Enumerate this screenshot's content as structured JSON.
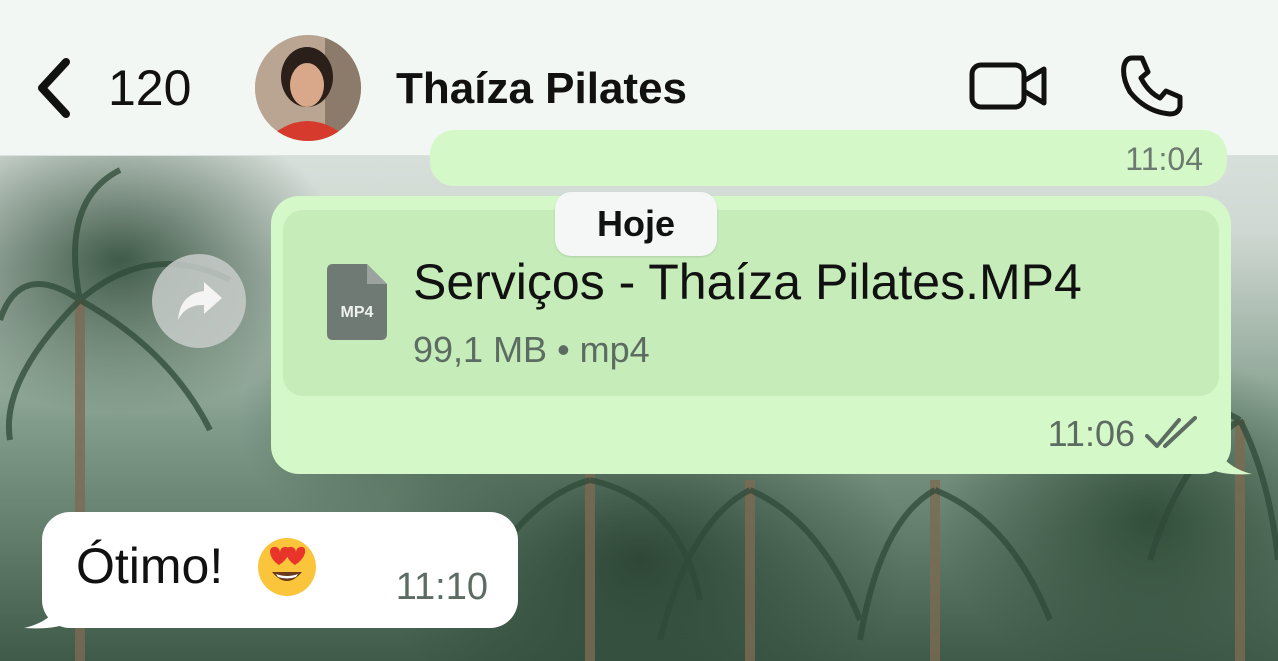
{
  "header": {
    "back_count": "120",
    "contact_name": "Thaíza Pilates",
    "icons": [
      "chevron-left-icon",
      "video-call-icon",
      "phone-icon"
    ]
  },
  "messages": {
    "previous": {
      "time": "11:04"
    },
    "date_divider": "Hoje",
    "file": {
      "badge": "MP4",
      "name": "Serviços - Thaíza Pilates.MP4",
      "meta": "99,1 MB • mp4",
      "time": "11:06",
      "status": "read"
    },
    "reply": {
      "text": "Ótimo!",
      "emoji": "😍",
      "time": "11:10"
    }
  },
  "colors": {
    "outgoing_bubble": "#d4f8c8",
    "file_card": "#c6ecba",
    "incoming_bubble": "#ffffff",
    "header_bg": "#f2f7f4"
  }
}
